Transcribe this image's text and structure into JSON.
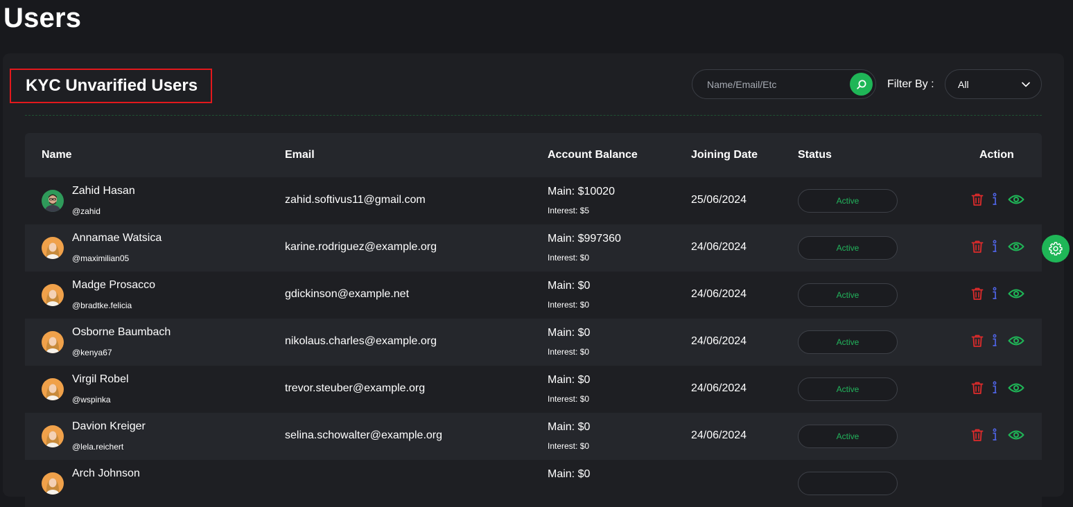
{
  "page": {
    "title": "Users"
  },
  "card": {
    "title": "KYC Unvarified Users",
    "search": {
      "placeholder": "Name/Email/Etc",
      "value": ""
    },
    "filter": {
      "label": "Filter By :",
      "selected": "All"
    }
  },
  "table": {
    "headers": {
      "name": "Name",
      "email": "Email",
      "balance": "Account Balance",
      "joining": "Joining Date",
      "status": "Status",
      "action": "Action"
    },
    "rows": [
      {
        "name": "Zahid Hasan",
        "handle": "@zahid",
        "email": "zahid.softivus11@gmail.com",
        "main": "Main: $10020",
        "interest": "Interest: $5",
        "date": "25/06/2024",
        "status": "Active",
        "avatar": "photo-man"
      },
      {
        "name": "Annamae Watsica",
        "handle": "@maximilian05",
        "email": "karine.rodriguez@example.org",
        "main": "Main: $997360",
        "interest": "Interest: $0",
        "date": "24/06/2024",
        "status": "Active",
        "avatar": "photo-woman"
      },
      {
        "name": "Madge Prosacco",
        "handle": "@bradtke.felicia",
        "email": "gdickinson@example.net",
        "main": "Main: $0",
        "interest": "Interest: $0",
        "date": "24/06/2024",
        "status": "Active",
        "avatar": "photo-woman"
      },
      {
        "name": "Osborne Baumbach",
        "handle": "@kenya67",
        "email": "nikolaus.charles@example.org",
        "main": "Main: $0",
        "interest": "Interest: $0",
        "date": "24/06/2024",
        "status": "Active",
        "avatar": "photo-woman"
      },
      {
        "name": "Virgil Robel",
        "handle": "@wspinka",
        "email": "trevor.steuber@example.org",
        "main": "Main: $0",
        "interest": "Interest: $0",
        "date": "24/06/2024",
        "status": "Active",
        "avatar": "photo-woman"
      },
      {
        "name": "Davion Kreiger",
        "handle": "@lela.reichert",
        "email": "selina.schowalter@example.org",
        "main": "Main: $0",
        "interest": "Interest: $0",
        "date": "24/06/2024",
        "status": "Active",
        "avatar": "photo-woman"
      },
      {
        "name": "Arch Johnson",
        "handle": "",
        "email": "",
        "main": "Main: $0",
        "interest": "",
        "date": "",
        "status": "",
        "avatar": "photo-woman"
      }
    ]
  },
  "icons": {
    "search": "search-icon",
    "dropdown": "chevron-down-icon",
    "delete": "trash-icon",
    "info": "info-icon",
    "view": "eye-icon",
    "settings": "gear-icon"
  },
  "colors": {
    "accent": "#1fb657",
    "status_active": "#22b45c",
    "delete": "#e02b2b",
    "info": "#4f64e6",
    "highlight_border": "#e3181c"
  }
}
